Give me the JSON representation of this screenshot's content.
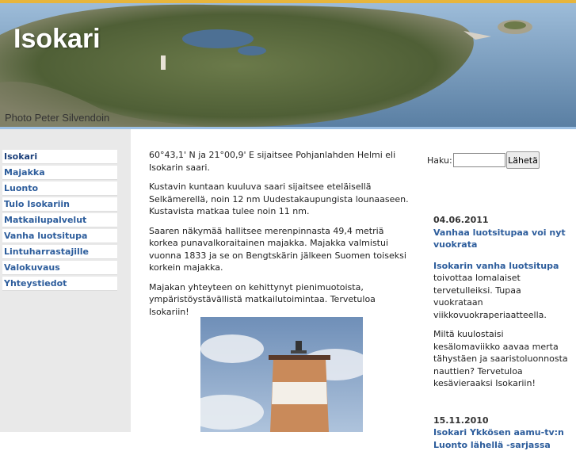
{
  "header": {
    "title": "Isokari",
    "photo_credit": "Photo Peter Silvendoin"
  },
  "nav": {
    "items": [
      {
        "label": "Isokari"
      },
      {
        "label": "Majakka"
      },
      {
        "label": "Luonto"
      },
      {
        "label": "Tulo Isokariin"
      },
      {
        "label": "Matkailupalvelut"
      },
      {
        "label": "Vanha luotsitupa"
      },
      {
        "label": "Lintuharrastajille"
      },
      {
        "label": "Valokuvaus"
      },
      {
        "label": "Yhteystiedot"
      }
    ]
  },
  "main": {
    "paragraphs": [
      "60°43,1' N ja 21°00,9' E sijaitsee Pohjanlahden Helmi eli Isokarin saari.",
      "Kustavin kuntaan kuuluva saari sijaitsee eteläisellä Selkämerellä, noin 12 nm Uudestakaupungista lounaaseen. Kustavista matkaa tulee noin 11 nm.",
      "Saaren näkymää hallitsee merenpinnasta 49,4 metriä korkea punavalkoraitainen majakka. Majakka valmistui vuonna 1833 ja se on Bengtskärin jälkeen Suomen toiseksi korkein majakka.",
      "Majakan yhteyteen on kehittynyt pienimuotoista, ympäristöystävällistä matkailutoimintaa. Tervetuloa Isokariin!"
    ]
  },
  "search": {
    "label": "Haku:",
    "placeholder": "",
    "button": "Lähetä"
  },
  "news": {
    "items": [
      {
        "date": "04.06.2011",
        "title": "Vanhaa luotsitupaa voi nyt vuokrata",
        "link": "Isokarin vanha luotsitupa",
        "text1": "toivottaa lomalaiset tervetulleiksi. Tupaa vuokrataan viikkovuokraperiaatteella.",
        "text2": "Miltä kuulostaisi kesälomaviikko aavaa merta tähystäen ja saaristoluonnosta nauttien? Tervetuloa kesävieraaksi Isokariin!"
      },
      {
        "date": "15.11.2010",
        "title": "Isokari Ykkösen aamu-tv:n Luonto lähellä -sarjassa"
      }
    ]
  },
  "colors": {
    "accent_top": "#e7b53c",
    "link": "#2d5d9c",
    "sidebar_bg": "#e9e9e9"
  }
}
